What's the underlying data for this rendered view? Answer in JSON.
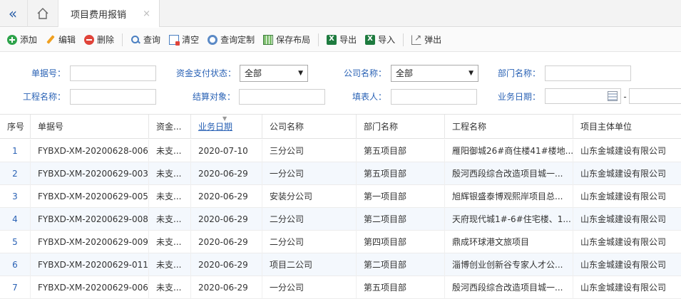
{
  "tabs": {
    "active_title": "项目费用报销",
    "close_glyph": "×"
  },
  "toolbar": {
    "add": "添加",
    "edit": "编辑",
    "delete": "删除",
    "query": "查询",
    "clear": "清空",
    "custom_query": "查询定制",
    "save_layout": "保存布局",
    "export": "导出",
    "import": "导入",
    "popout": "弹出"
  },
  "form": {
    "doc_no_label": "单据号：",
    "fund_status_label": "资金支付状态：",
    "fund_status_value": "全部",
    "company_label": "公司名称：",
    "company_value": "全部",
    "dept_label": "部门名称：",
    "project_label": "工程名称：",
    "settle_label": "结算对象：",
    "filler_label": "填表人：",
    "biz_date_label": "业务日期：",
    "date_sep": "-"
  },
  "grid": {
    "headers": {
      "seq": "序号",
      "doc_no": "单据号",
      "fund": "资金...",
      "date": "业务日期",
      "company": "公司名称",
      "dept": "部门名称",
      "project": "工程名称",
      "unit": "项目主体单位"
    },
    "rows": [
      {
        "seq": "1",
        "doc_no": "FYBXD-XM-20200628-006",
        "fund": "未支...",
        "date": "2020-07-10",
        "company": "三分公司",
        "dept": "第五项目部",
        "project": "雁阳御城26#商住楼41#楼地...",
        "unit": "山东金城建设有限公司"
      },
      {
        "seq": "2",
        "doc_no": "FYBXD-XM-20200629-003",
        "fund": "未支...",
        "date": "2020-06-29",
        "company": "一分公司",
        "dept": "第五项目部",
        "project": "殷河西段综合改造项目城一...",
        "unit": "山东金城建设有限公司"
      },
      {
        "seq": "3",
        "doc_no": "FYBXD-XM-20200629-005",
        "fund": "未支...",
        "date": "2020-06-29",
        "company": "安装分公司",
        "dept": "第一项目部",
        "project": "旭辉银盛泰博观熙岸项目总...",
        "unit": "山东金城建设有限公司"
      },
      {
        "seq": "4",
        "doc_no": "FYBXD-XM-20200629-008",
        "fund": "未支...",
        "date": "2020-06-29",
        "company": "二分公司",
        "dept": "第二项目部",
        "project": "天府现代城1#-6#住宅楼、1...",
        "unit": "山东金城建设有限公司"
      },
      {
        "seq": "5",
        "doc_no": "FYBXD-XM-20200629-009",
        "fund": "未支...",
        "date": "2020-06-29",
        "company": "二分公司",
        "dept": "第四项目部",
        "project": "鼎成环球港文旅项目",
        "unit": "山东金城建设有限公司"
      },
      {
        "seq": "6",
        "doc_no": "FYBXD-XM-20200629-011",
        "fund": "未支...",
        "date": "2020-06-29",
        "company": "项目二公司",
        "dept": "第二项目部",
        "project": "淄博创业创新谷专家人才公...",
        "unit": "山东金城建设有限公司"
      },
      {
        "seq": "7",
        "doc_no": "FYBXD-XM-20200629-006",
        "fund": "未支...",
        "date": "2020-06-29",
        "company": "一分公司",
        "dept": "第五项目部",
        "project": "殷河西段综合改造项目城一...",
        "unit": "山东金城建设有限公司"
      }
    ]
  }
}
